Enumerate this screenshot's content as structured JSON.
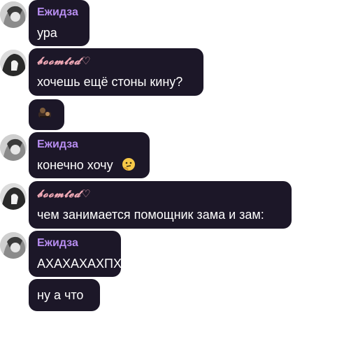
{
  "messages": [
    {
      "sender": "Ежидза",
      "text": "ура"
    },
    {
      "sender": "𝓫𝓸𝓸𝓶𝓽𝓮𝓭♡",
      "text": "хочешь ещё стоны кину?"
    },
    {
      "sticker": "dark-sticker-icon"
    },
    {
      "sender": "Ежидза",
      "text": "конечно хочу",
      "emoji": "thinking-face-icon"
    },
    {
      "sender": "𝓫𝓸𝓸𝓶𝓽𝓮𝓭♡",
      "text": "чем занимается помощник зама и зам:"
    },
    {
      "sender": "Ежидза",
      "text": "АХАХАХАХПХ"
    },
    {
      "text": "ну а что"
    }
  ],
  "colors": {
    "bubble_bg": "#1c1728",
    "sender_purple": "#b78df0",
    "sender_pink": "#f0a9b6"
  }
}
